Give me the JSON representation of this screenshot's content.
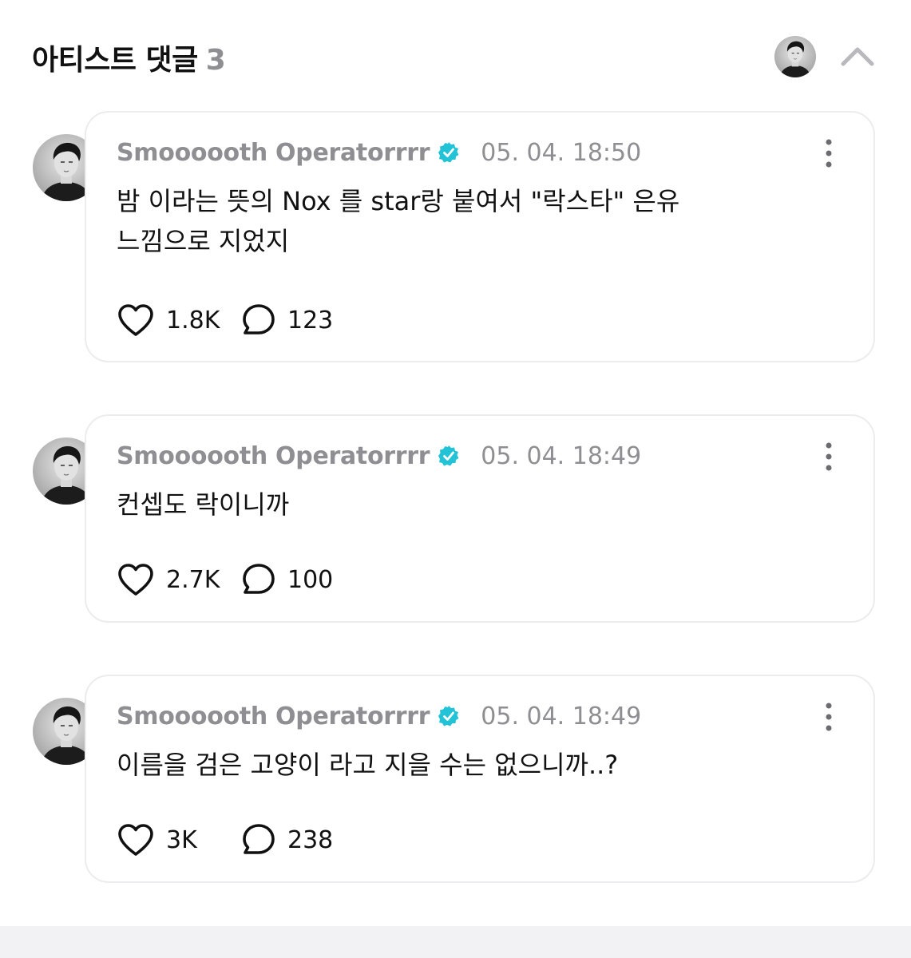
{
  "header": {
    "title": "아티스트 댓글",
    "count": "3"
  },
  "colors": {
    "verified_badge": "#22c3d6",
    "muted_text": "#8e8e93",
    "card_border": "#ececef"
  },
  "icons": {
    "collapse": "chevron-up-icon",
    "like": "heart-outline-icon",
    "reply": "speech-bubble-icon",
    "more": "vertical-dots-icon",
    "verified": "verified-badge-icon"
  },
  "comments": [
    {
      "author": "Smoooooth Operatorrrr",
      "timestamp": "05. 04. 18:50",
      "text_lines": [
        "밤 이라는 뜻의 Nox 를 star랑 붙여서 \"락스타\" 은유",
        "느낌으로 지었지"
      ],
      "likes": "1.8K",
      "replies": "123"
    },
    {
      "author": "Smoooooth Operatorrrr",
      "timestamp": "05. 04. 18:49",
      "text_lines": [
        "컨셉도 락이니까"
      ],
      "likes": "2.7K",
      "replies": "100"
    },
    {
      "author": "Smoooooth Operatorrrr",
      "timestamp": "05. 04. 18:49",
      "text_lines": [
        "이름을 검은 고양이 라고 지을 수는 없으니까..?"
      ],
      "likes": "3K",
      "replies": "238"
    }
  ]
}
